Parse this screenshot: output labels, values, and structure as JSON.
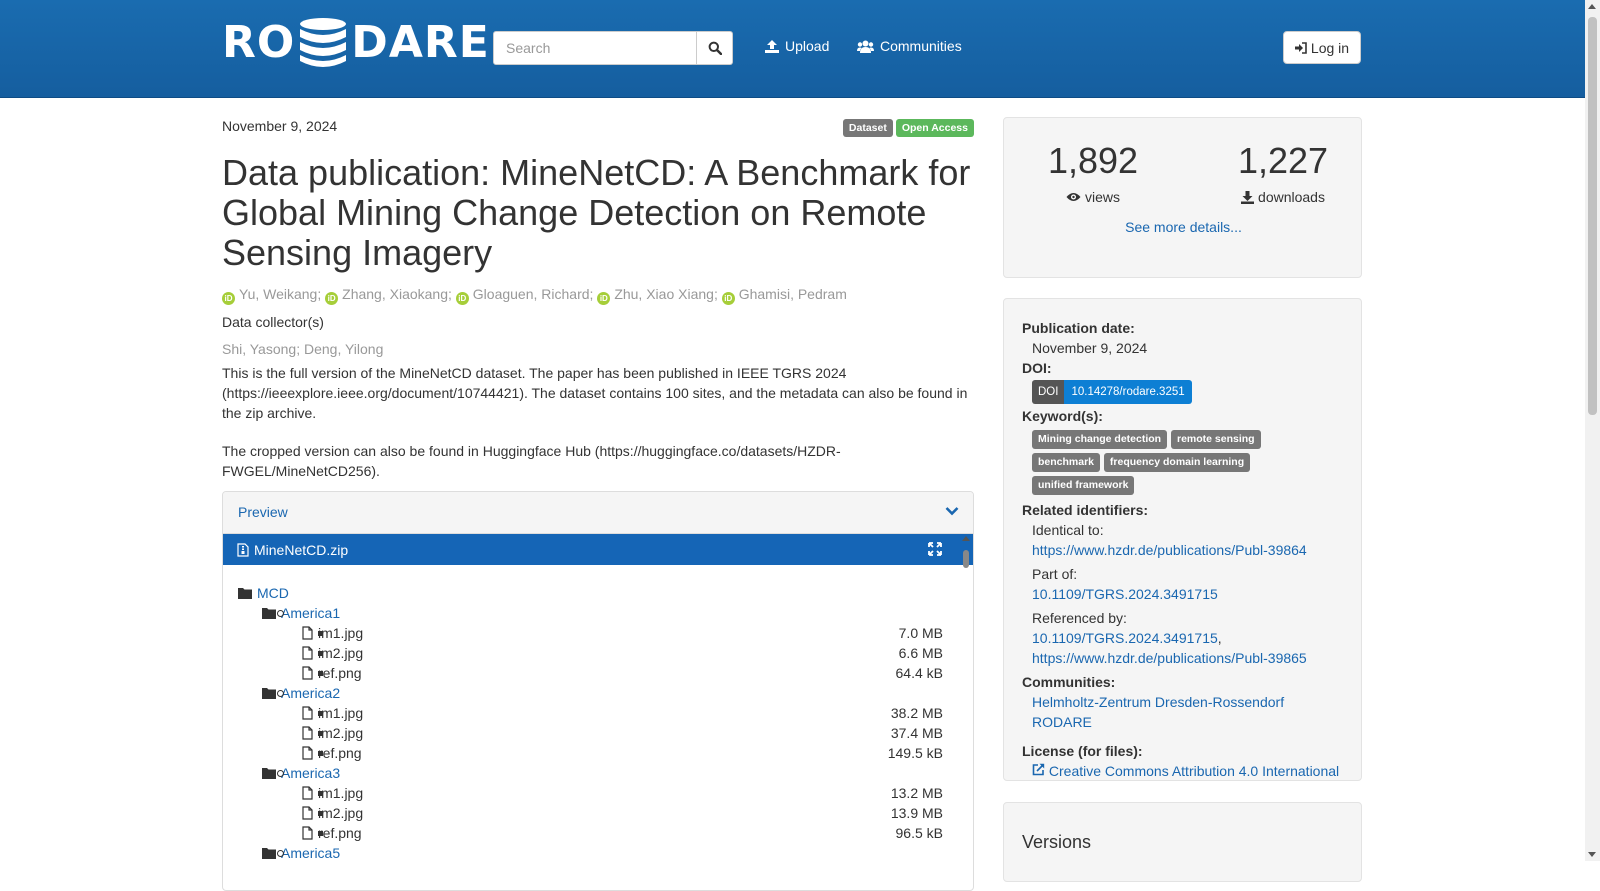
{
  "header": {
    "logo_left": "RO",
    "logo_right": "DARE",
    "search_placeholder": "Search",
    "upload_label": "Upload",
    "communities_label": "Communities",
    "login_label": "Log in"
  },
  "record": {
    "date": "November 9, 2024",
    "badges": [
      "Dataset",
      "Open Access"
    ],
    "title": "Data publication: MineNetCD: A Benchmark for Global Mining Change Detection on Remote Sensing Imagery",
    "authors": [
      "Yu, Weikang",
      "Zhang, Xiaokang",
      "Gloaguen, Richard",
      "Zhu, Xiao Xiang",
      "Ghamisi, Pedram"
    ],
    "collectors_heading": "Data collector(s)",
    "collectors": "Shi, Yasong; Deng, Yilong",
    "description_1": "This is the full version of the MineNetCD dataset. The paper has been published in IEEE TGRS 2024 (https://ieeexplore.ieee.org/document/10744421). The dataset contains 100 sites, and the metadata can also be found in the zip archive.",
    "description_2": "The cropped version can also be found in Huggingface Hub (https://huggingface.co/datasets/HZDR-FWGEL/MineNetCD256)."
  },
  "preview": {
    "heading": "Preview",
    "file": "MineNetCD.zip",
    "root": "MCD",
    "folders": [
      {
        "name": "America1",
        "files": [
          {
            "name": "im1.jpg",
            "size": "7.0 MB"
          },
          {
            "name": "im2.jpg",
            "size": "6.6 MB"
          },
          {
            "name": "ref.png",
            "size": "64.4 kB"
          }
        ]
      },
      {
        "name": "America2",
        "files": [
          {
            "name": "im1.jpg",
            "size": "38.2 MB"
          },
          {
            "name": "im2.jpg",
            "size": "37.4 MB"
          },
          {
            "name": "ref.png",
            "size": "149.5 kB"
          }
        ]
      },
      {
        "name": "America3",
        "files": [
          {
            "name": "im1.jpg",
            "size": "13.2 MB"
          },
          {
            "name": "im2.jpg",
            "size": "13.9 MB"
          },
          {
            "name": "ref.png",
            "size": "96.5 kB"
          }
        ]
      },
      {
        "name": "America5",
        "files": []
      }
    ]
  },
  "stats": {
    "views": "1,892",
    "views_label": "views",
    "downloads": "1,227",
    "downloads_label": "downloads",
    "more_label": "See more details..."
  },
  "meta": {
    "pubdate_label": "Publication date:",
    "pubdate": "November 9, 2024",
    "doi_label": "DOI:",
    "doi_prefix": "DOI",
    "doi": "10.14278/rodare.3251",
    "keywords_label": "Keyword(s):",
    "keywords": [
      "Mining change detection",
      "remote sensing",
      "benchmark",
      "frequency domain learning",
      "unified framework"
    ],
    "related_label": "Related identifiers:",
    "identical_label": "Identical to:",
    "identical_link": "https://www.hzdr.de/publications/Publ-39864",
    "partof_label": "Part of:",
    "partof_link": "10.1109/TGRS.2024.3491715",
    "referenced_label": "Referenced by:",
    "referenced_link_1": "10.1109/TGRS.2024.3491715",
    "referenced_link_2": "https://www.hzdr.de/publications/Publ-39865",
    "communities_label": "Communities:",
    "community_1": "Helmholtz-Zentrum Dresden-Rossendorf",
    "community_2": "RODARE",
    "license_label": "License (for files):",
    "license": "Creative Commons Attribution 4.0 International"
  },
  "versions": {
    "heading": "Versions"
  }
}
